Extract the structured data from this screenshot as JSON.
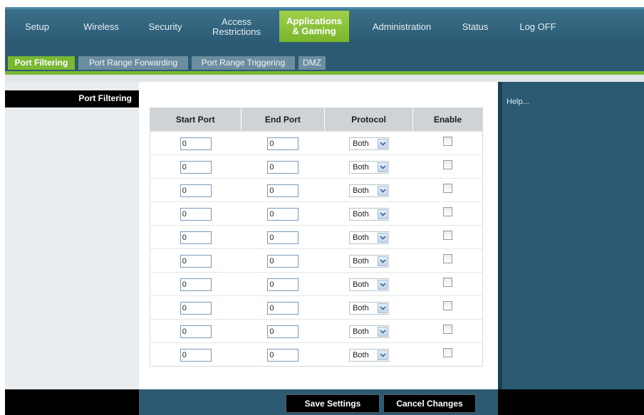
{
  "nav": {
    "items": [
      {
        "label": "Setup"
      },
      {
        "label": "Wireless"
      },
      {
        "label": "Security"
      },
      {
        "label": "Access\nRestrictions"
      },
      {
        "label": "Applications\n& Gaming"
      },
      {
        "label": "Administration"
      },
      {
        "label": "Status"
      },
      {
        "label": "Log OFF"
      }
    ],
    "active": "Applications & Gaming"
  },
  "subtabs": {
    "items": [
      {
        "label": "Port Filtering"
      },
      {
        "label": "Port Range Forwarding"
      },
      {
        "label": "Port Range Triggering"
      },
      {
        "label": "DMZ"
      }
    ],
    "active": "Port Filtering"
  },
  "sidebar": {
    "section_title": "Port Filtering"
  },
  "table": {
    "headers": [
      "Start Port",
      "End Port",
      "Protocol",
      "Enable"
    ],
    "rows": [
      {
        "start": "0",
        "end": "0",
        "protocol": "Both",
        "enabled": false
      },
      {
        "start": "0",
        "end": "0",
        "protocol": "Both",
        "enabled": false
      },
      {
        "start": "0",
        "end": "0",
        "protocol": "Both",
        "enabled": false
      },
      {
        "start": "0",
        "end": "0",
        "protocol": "Both",
        "enabled": false
      },
      {
        "start": "0",
        "end": "0",
        "protocol": "Both",
        "enabled": false
      },
      {
        "start": "0",
        "end": "0",
        "protocol": "Both",
        "enabled": false
      },
      {
        "start": "0",
        "end": "0",
        "protocol": "Both",
        "enabled": false
      },
      {
        "start": "0",
        "end": "0",
        "protocol": "Both",
        "enabled": false
      },
      {
        "start": "0",
        "end": "0",
        "protocol": "Both",
        "enabled": false
      },
      {
        "start": "0",
        "end": "0",
        "protocol": "Both",
        "enabled": false
      }
    ]
  },
  "help": {
    "link": "Help..."
  },
  "footer": {
    "save_label": "Save Settings",
    "cancel_label": "Cancel Changes"
  },
  "colors": {
    "nav_bg": "#2c5a73",
    "accent_green": "#7ab833",
    "header_gray": "#cfd3d6"
  }
}
